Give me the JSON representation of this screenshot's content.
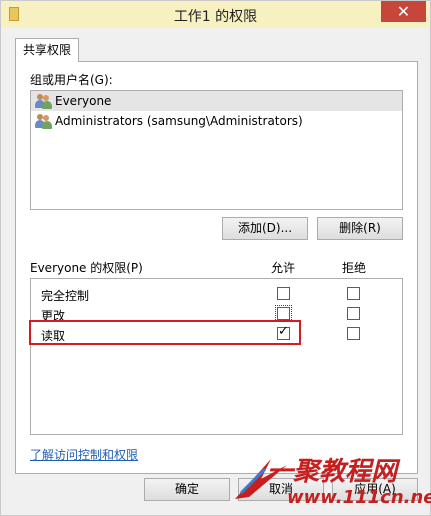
{
  "window": {
    "title": "工作1 的权限"
  },
  "tabs": [
    {
      "label": "共享权限"
    }
  ],
  "users": {
    "label": "组或用户名(G):",
    "items": [
      {
        "name": "Everyone",
        "selected": true
      },
      {
        "name": "Administrators (samsung\\Administrators)",
        "selected": false
      }
    ]
  },
  "buttons": {
    "add": "添加(D)...",
    "remove": "删除(R)",
    "ok": "确定",
    "cancel": "取消",
    "apply": "应用(A)"
  },
  "permissions": {
    "label": "Everyone 的权限(P)",
    "allow_header": "允许",
    "deny_header": "拒绝",
    "rows": [
      {
        "name": "完全控制",
        "allow": false,
        "deny": false
      },
      {
        "name": "更改",
        "allow": false,
        "deny": false
      },
      {
        "name": "读取",
        "allow": true,
        "deny": false
      }
    ]
  },
  "link": "了解访问控制和权限",
  "watermark": {
    "text": "一聚教程网",
    "url": "www.111cn.net"
  },
  "colors": {
    "highlight": "#d71920",
    "close": "#c7463a",
    "titlebar": "#f7f1c2",
    "link": "#1f5fb5"
  }
}
